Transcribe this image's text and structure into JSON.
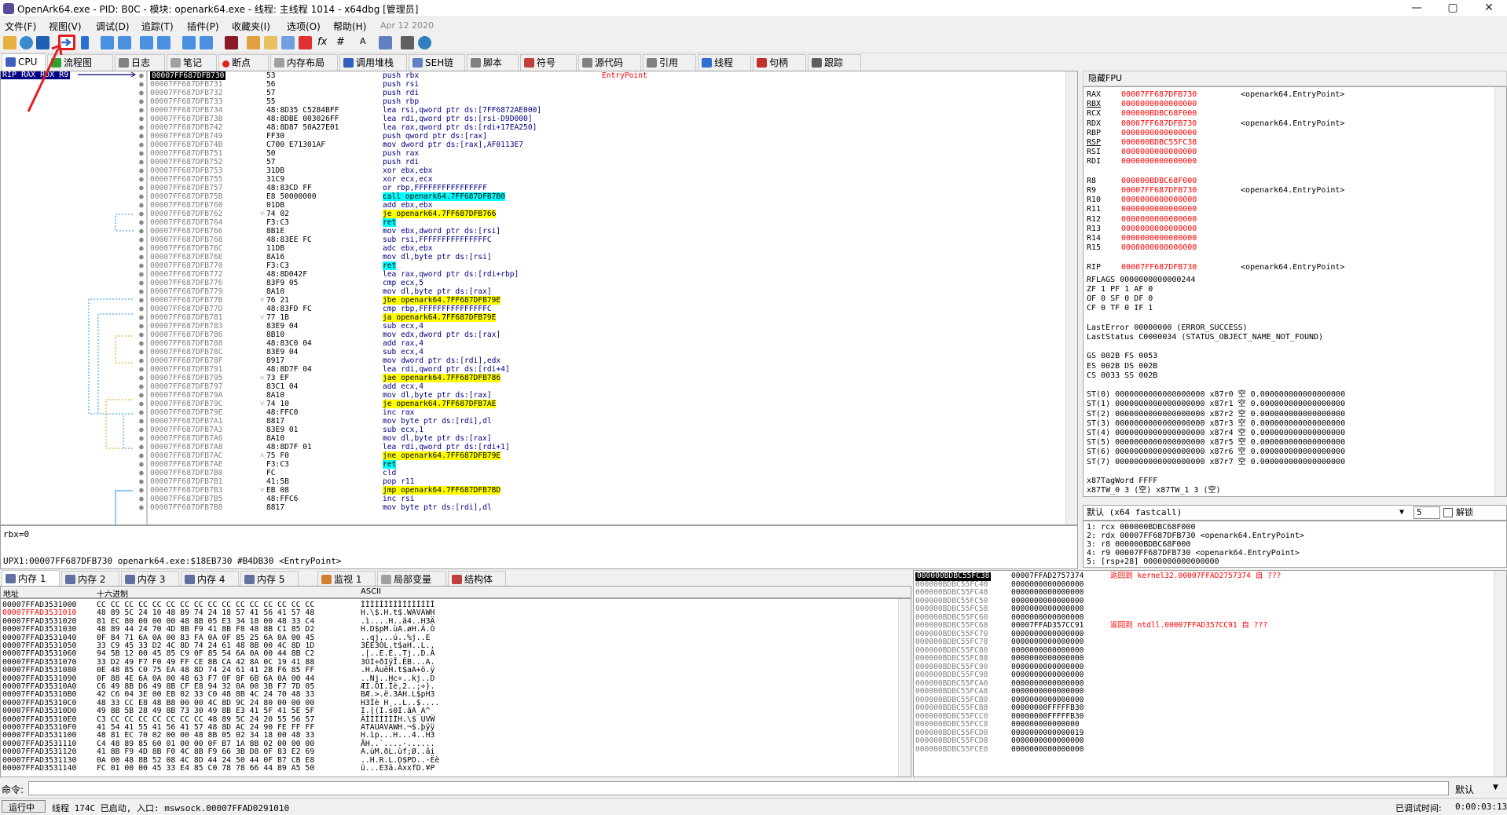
{
  "window": {
    "title": "OpenArk64.exe - PID: B0C - 模块: openark64.exe - 线程: 主线程 1014 - x64dbg [管理员]",
    "min": "—",
    "max": "▢",
    "close": "✕"
  },
  "menu": {
    "items": [
      "文件(F)",
      "视图(V)",
      "调试(D)",
      "追踪(T)",
      "插件(P)",
      "收藏夹(I)",
      "选项(O)",
      "帮助(H)"
    ],
    "date": "Apr 12 2020"
  },
  "tabs": [
    {
      "label": "CPU",
      "color": "#4060c0"
    },
    {
      "label": "流程图",
      "color": "#30a030"
    },
    {
      "label": "日志",
      "color": "#808080"
    },
    {
      "label": "笔记",
      "color": "#a0a0a0"
    },
    {
      "label": "断点",
      "color": "#e02020"
    },
    {
      "label": "内存布局",
      "color": "#a0a0a0"
    },
    {
      "label": "调用堆栈",
      "color": "#3060c0"
    },
    {
      "label": "SEH链",
      "color": "#6080c0"
    },
    {
      "label": "脚本",
      "color": "#808080"
    },
    {
      "label": "符号",
      "color": "#c04040"
    },
    {
      "label": "源代码",
      "color": "#808080"
    },
    {
      "label": "引用",
      "color": "#808080"
    },
    {
      "label": "线程",
      "color": "#3070d0"
    },
    {
      "label": "句柄",
      "color": "#c03030"
    },
    {
      "label": "跟踪",
      "color": "#606060"
    }
  ],
  "rip_label": "RIP RAX RDX R9",
  "disasm": [
    {
      "addr": "00007FF687DFB730",
      "bytes": "53",
      "asm": "push rbx",
      "cmt": "EntryPoint",
      "cur": true
    },
    {
      "addr": "00007FF687DFB731",
      "bytes": "56",
      "asm": "push rsi"
    },
    {
      "addr": "00007FF687DFB732",
      "bytes": "57",
      "asm": "push rdi"
    },
    {
      "addr": "00007FF687DFB733",
      "bytes": "55",
      "asm": "push rbp"
    },
    {
      "addr": "00007FF687DFB734",
      "bytes": "48:8D35 C5284BFF",
      "asm": "lea rsi,qword ptr ds:[7FF6872AE000]"
    },
    {
      "addr": "00007FF687DFB73B",
      "bytes": "48:8DBE 003026FF",
      "asm": "lea rdi,qword ptr ds:[rsi-D9D000]"
    },
    {
      "addr": "00007FF687DFB742",
      "bytes": "48:8D87 50A27E01",
      "asm": "lea rax,qword ptr ds:[rdi+17EA250]"
    },
    {
      "addr": "00007FF687DFB749",
      "bytes": "FF30",
      "asm": "push qword ptr ds:[rax]"
    },
    {
      "addr": "00007FF687DFB74B",
      "bytes": "C700 E71301AF",
      "asm": "mov dword ptr ds:[rax],AF0113E7"
    },
    {
      "addr": "00007FF687DFB751",
      "bytes": "50",
      "asm": "push rax"
    },
    {
      "addr": "00007FF687DFB752",
      "bytes": "57",
      "asm": "push rdi"
    },
    {
      "addr": "00007FF687DFB753",
      "bytes": "31DB",
      "asm": "xor ebx,ebx"
    },
    {
      "addr": "00007FF687DFB755",
      "bytes": "31C9",
      "asm": "xor ecx,ecx"
    },
    {
      "addr": "00007FF687DFB757",
      "bytes": "48:83CD FF",
      "asm": "or rbp,FFFFFFFFFFFFFFFF"
    },
    {
      "addr": "00007FF687DFB75B",
      "bytes": "E8 50000000",
      "asm": "call openark64.7FF687DFB7B0",
      "hl": "call"
    },
    {
      "addr": "00007FF687DFB760",
      "bytes": "01DB",
      "asm": "add ebx,ebx"
    },
    {
      "addr": "00007FF687DFB762",
      "bytes": "74 02",
      "asm": "je openark64.7FF687DFB766",
      "hl": "jmp",
      "arrow": "˅"
    },
    {
      "addr": "00007FF687DFB764",
      "bytes": "F3:C3",
      "asm": "ret",
      "hl": "call"
    },
    {
      "addr": "00007FF687DFB766",
      "bytes": "8B1E",
      "asm": "mov ebx,dword ptr ds:[rsi]"
    },
    {
      "addr": "00007FF687DFB768",
      "bytes": "48:83EE FC",
      "asm": "sub rsi,FFFFFFFFFFFFFFFC"
    },
    {
      "addr": "00007FF687DFB76C",
      "bytes": "11DB",
      "asm": "adc ebx,ebx"
    },
    {
      "addr": "00007FF687DFB76E",
      "bytes": "8A16",
      "asm": "mov dl,byte ptr ds:[rsi]"
    },
    {
      "addr": "00007FF687DFB770",
      "bytes": "F3:C3",
      "asm": "ret",
      "hl": "call"
    },
    {
      "addr": "00007FF687DFB772",
      "bytes": "48:8D042F",
      "asm": "lea rax,qword ptr ds:[rdi+rbp]"
    },
    {
      "addr": "00007FF687DFB776",
      "bytes": "83F9 05",
      "asm": "cmp ecx,5"
    },
    {
      "addr": "00007FF687DFB779",
      "bytes": "8A10",
      "asm": "mov dl,byte ptr ds:[rax]"
    },
    {
      "addr": "00007FF687DFB77B",
      "bytes": "76 21",
      "asm": "jbe openark64.7FF687DFB79E",
      "hl": "jmp",
      "arrow": "˅"
    },
    {
      "addr": "00007FF687DFB77D",
      "bytes": "48:83FD FC",
      "asm": "cmp rbp,FFFFFFFFFFFFFFFC"
    },
    {
      "addr": "00007FF687DFB781",
      "bytes": "77 1B",
      "asm": "ja openark64.7FF687DFB79E",
      "hl": "jmp",
      "arrow": "˅"
    },
    {
      "addr": "00007FF687DFB783",
      "bytes": "83E9 04",
      "asm": "sub ecx,4"
    },
    {
      "addr": "00007FF687DFB786",
      "bytes": "8B10",
      "asm": "mov edx,dword ptr ds:[rax]"
    },
    {
      "addr": "00007FF687DFB788",
      "bytes": "48:83C0 04",
      "asm": "add rax,4"
    },
    {
      "addr": "00007FF687DFB78C",
      "bytes": "83E9 04",
      "asm": "sub ecx,4"
    },
    {
      "addr": "00007FF687DFB78F",
      "bytes": "8917",
      "asm": "mov dword ptr ds:[rdi],edx"
    },
    {
      "addr": "00007FF687DFB791",
      "bytes": "48:8D7F 04",
      "asm": "lea rdi,qword ptr ds:[rdi+4]"
    },
    {
      "addr": "00007FF687DFB795",
      "bytes": "73 EF",
      "asm": "jae openark64.7FF687DFB786",
      "hl": "jmp",
      "arrow": "˄"
    },
    {
      "addr": "00007FF687DFB797",
      "bytes": "83C1 04",
      "asm": "add ecx,4"
    },
    {
      "addr": "00007FF687DFB79A",
      "bytes": "8A10",
      "asm": "mov dl,byte ptr ds:[rax]"
    },
    {
      "addr": "00007FF687DFB79C",
      "bytes": "74 10",
      "asm": "je openark64.7FF687DFB7AE",
      "hl": "jmp",
      "arrow": "˅"
    },
    {
      "addr": "00007FF687DFB79E",
      "bytes": "48:FFC0",
      "asm": "inc rax"
    },
    {
      "addr": "00007FF687DFB7A1",
      "bytes": "8817",
      "asm": "mov byte ptr ds:[rdi],dl"
    },
    {
      "addr": "00007FF687DFB7A3",
      "bytes": "83E9 01",
      "asm": "sub ecx,1"
    },
    {
      "addr": "00007FF687DFB7A6",
      "bytes": "8A10",
      "asm": "mov dl,byte ptr ds:[rax]"
    },
    {
      "addr": "00007FF687DFB7A8",
      "bytes": "48:8D7F 01",
      "asm": "lea rdi,qword ptr ds:[rdi+1]"
    },
    {
      "addr": "00007FF687DFB7AC",
      "bytes": "75 F0",
      "asm": "jne openark64.7FF687DFB79E",
      "hl": "jmp",
      "arrow": "˄"
    },
    {
      "addr": "00007FF687DFB7AE",
      "bytes": "F3:C3",
      "asm": "ret",
      "hl": "call"
    },
    {
      "addr": "00007FF687DFB7B0",
      "bytes": "FC",
      "asm": "cld"
    },
    {
      "addr": "00007FF687DFB7B1",
      "bytes": "41:5B",
      "asm": "pop r11"
    },
    {
      "addr": "00007FF687DFB7B3",
      "bytes": "EB 08",
      "asm": "jmp openark64.7FF687DFB7BD",
      "hl": "jmp",
      "arrow": "˅"
    },
    {
      "addr": "00007FF687DFB7B5",
      "bytes": "48:FFC6",
      "asm": "inc rsi"
    },
    {
      "addr": "00007FF687DFB7B8",
      "bytes": "8817",
      "asm": "mov byte ptr ds:[rdi],dl"
    }
  ],
  "info": {
    "line1": "rbx=0",
    "line2": "UPX1:00007FF687DFB730 openark64.exe:$18EB730 #B4DB30 <EntryPoint>"
  },
  "reg_header": "隐藏FPU",
  "registers": [
    {
      "n": "RAX",
      "v": "00007FF687DFB730",
      "c": "<openark64.EntryPoint>",
      "red": true
    },
    {
      "n": "RBX",
      "v": "0000000000000000",
      "u": true,
      "red": true
    },
    {
      "n": "RCX",
      "v": "000000BDBC68F000",
      "red": true
    },
    {
      "n": "RDX",
      "v": "00007FF687DFB730",
      "c": "<openark64.EntryPoint>",
      "red": true
    },
    {
      "n": "RBP",
      "v": "0000000000000000",
      "red": true
    },
    {
      "n": "RSP",
      "v": "000000BDBC55FC38",
      "u": true,
      "red": true
    },
    {
      "n": "RSI",
      "v": "0000000000000000",
      "red": true
    },
    {
      "n": "RDI",
      "v": "0000000000000000",
      "red": true
    },
    {
      "n": "",
      "v": ""
    },
    {
      "n": "R8",
      "v": "000000BDBC68F000",
      "red": true
    },
    {
      "n": "R9",
      "v": "00007FF687DFB730",
      "c": "<openark64.EntryPoint>",
      "red": true
    },
    {
      "n": "R10",
      "v": "0000000000000000",
      "red": true
    },
    {
      "n": "R11",
      "v": "0000000000000000",
      "red": true
    },
    {
      "n": "R12",
      "v": "0000000000000000",
      "red": true
    },
    {
      "n": "R13",
      "v": "0000000000000000",
      "red": true
    },
    {
      "n": "R14",
      "v": "0000000000000000",
      "red": true
    },
    {
      "n": "R15",
      "v": "0000000000000000",
      "red": true
    },
    {
      "n": "",
      "v": ""
    },
    {
      "n": "RIP",
      "v": "00007FF687DFB730",
      "c": "<openark64.EntryPoint>",
      "red": true
    }
  ],
  "flags": [
    "RFLAGS  0000000000000244",
    "ZF 1  PF 1  AF 0",
    "OF 0  SF 0  DF 0",
    "CF 0  TF 0  IF 1",
    "",
    "LastError  00000000 (ERROR_SUCCESS)",
    "LastStatus C0000034 (STATUS_OBJECT_NAME_NOT_FOUND)",
    "",
    "GS 002B  FS 0053",
    "ES 002B  DS 002B",
    "CS 0033  SS 002B",
    "",
    "ST(0) 0000000000000000000 x87r0 空 0.000000000000000000",
    "ST(1) 0000000000000000000 x87r1 空 0.000000000000000000",
    "ST(2) 0000000000000000000 x87r2 空 0.000000000000000000",
    "ST(3) 0000000000000000000 x87r3 空 0.000000000000000000",
    "ST(4) 0000000000000000000 x87r4 空 0.000000000000000000",
    "ST(5) 0000000000000000000 x87r5 空 0.000000000000000000",
    "ST(6) 0000000000000000000 x87r6 空 0.000000000000000000",
    "ST(7) 0000000000000000000 x87r7 空 0.000000000000000000",
    "",
    "x87TagWord FFFF",
    "x87TW_0 3 (空)       x87TW_1 3 (空)"
  ],
  "callconv": {
    "label": "默认 (x64 fastcall)",
    "count": "5",
    "unlock": "解锁"
  },
  "args": [
    "1: rcx 000000BDBC68F000",
    "2: rdx 00007FF687DFB730 <openark64.EntryPoint>",
    "3: r8 000000BDBC68F000",
    "4: r9 00007FF687DFB730 <openark64.EntryPoint>",
    "5: [rsp+28] 0000000000000000"
  ],
  "mem_tabs": [
    "内存 1",
    "内存 2",
    "内存 3",
    "内存 4",
    "内存 5",
    "监视 1",
    "局部变量",
    "结构体"
  ],
  "mem_head": {
    "addr": "地址",
    "hex": "十六进制",
    "ascii": "ASCII"
  },
  "memory": [
    {
      "a": "00007FFAD3531000",
      "h": "CC CC CC CC CC CC CC CC CC CC CC CC CC CC CC CC",
      "t": "ÌÌÌÌÌÌÌÌÌÌÌÌÌÌÌÌ"
    },
    {
      "a": "00007FFAD3531010",
      "h": "48 89 5C 24 10 48 89 74 24 18 57 41 56 41 57 48",
      "t": "H.\\$.H.t$.WAVAWH",
      "red": true
    },
    {
      "a": "00007FFAD3531020",
      "h": "81 EC 80 00 00 00 48 8B 05 E3 34 18 00 48 33 C4",
      "t": ".ì....H..ã4..H3Ä"
    },
    {
      "a": "00007FFAD3531030",
      "h": "48 89 44 24 70 4D 8B F9 41 8B F8 48 8B C1 85 D2",
      "t": "H.D$pM.ùA.øH.Á.Ò"
    },
    {
      "a": "00007FFAD3531040",
      "h": "0F 84 71 6A 0A 00 83 FA 0A 0F 85 25 6A 0A 00 45",
      "t": "..qj...ú..%j..E"
    },
    {
      "a": "00007FFAD3531050",
      "h": "33 C9 45 33 D2 4C 8D 74 24 61 48 8B 00 4C 8D 1D",
      "t": "3ÉE3ÒL.t$aH..L.."
    },
    {
      "a": "00007FFAD3531060",
      "h": "94 5B 12 00 45 85 C9 0F 85 54 6A 0A 00 44 8B C2",
      "t": ".[..E.É..Tj..D.Â"
    },
    {
      "a": "00007FFAD3531070",
      "h": "33 D2 49 F7 F0 49 FF CE 8B CA 42 8A 0C 19 41 88",
      "t": "3ÒI÷ðIÿÎ.ÊB...A."
    },
    {
      "a": "00007FFAD3531080",
      "h": "0E 48 85 C0 75 EA 48 8D 74 24 61 41 2B F6 85 FF",
      "t": ".H.ÀuêH.t$aA+ö.ÿ"
    },
    {
      "a": "00007FFAD3531090",
      "h": "0F 88 4E 6A 0A 00 48 63 F7 0F 8F 6B 6A 0A 00 44",
      "t": "..Nj..Hc÷..kj..D"
    },
    {
      "a": "00007FFAD35310A0",
      "h": "C6 49 8B D6 49 8B CF E8 94 32 0A 00 3B F7 7D 05",
      "t": "ÆI.ÖI.Ïè.2..;÷}."
    },
    {
      "a": "00007FFAD35310B0",
      "h": "42 C6 04 3E 00 EB 02 33 C0 48 8B 4C 24 70 48 33",
      "t": "BÆ.>.ë.3ÀH.L$pH3"
    },
    {
      "a": "00007FFAD35310C0",
      "h": "48 33 CC E8 48 B8 00 00 4C 8D 9C 24 80 00 00 00",
      "t": "H3Ìè H¸..L..$...."
    },
    {
      "a": "00007FFAD35310D0",
      "h": "49 8B 5B 28 49 8B 73 30 49 8B E3 41 5F 41 5E 5F",
      "t": "I.[(I.s0I.ãA_A^_"
    },
    {
      "a": "00007FFAD35310E0",
      "h": "C3 CC CC CC CC CC CC CC 48 89 5C 24 20 55 56 57",
      "t": "ÃÌÌÌÌÌÌÌH.\\$ UVW"
    },
    {
      "a": "00007FFAD35310F0",
      "h": "41 54 41 55 41 56 41 57 48 8D AC 24 90 FE FF FF",
      "t": "ATAUAVAWH.¬$.þÿÿ"
    },
    {
      "a": "00007FFAD3531100",
      "h": "48 81 EC 70 02 00 00 48 8B 05 02 34 18 00 48 33",
      "t": "H.ìp...H...4..H3"
    },
    {
      "a": "00007FFAD3531110",
      "h": "C4 48 89 85 60 01 00 00 0F B7 1A 8B 02 00 00 00",
      "t": "ÄH..`....·......"
    },
    {
      "a": "00007FFAD3531120",
      "h": "41 8B F9 4D 8B F0 4C 8B F9 66 3B D8 0F 83 E2 69",
      "t": "A.ùM.ðL.ùf;Ø..âi"
    },
    {
      "a": "00007FFAD3531130",
      "h": "0A 00 48 8B 52 08 4C 8D 44 24 50 44 0F B7 CB E8",
      "t": "..H.R.L.D$PD..·Ëè"
    },
    {
      "a": "00007FFAD3531140",
      "h": "FC 01 00 00 45 33 E4 85 C0 78 78 66 44 89 A5 50",
      "t": "ü...E3ä.ÀxxfD.¥P"
    }
  ],
  "stack": [
    {
      "a": "000000BDBC55FC38",
      "v": "00007FFAD2757374",
      "c": "返回到 kernel32.00007FFAD2757374 自 ???",
      "cur": true
    },
    {
      "a": "000000BDBC55FC40",
      "v": "0000000000000000"
    },
    {
      "a": "000000BDBC55FC48",
      "v": "0000000000000000"
    },
    {
      "a": "000000BDBC55FC50",
      "v": "0000000000000000"
    },
    {
      "a": "000000BDBC55FC58",
      "v": "0000000000000000"
    },
    {
      "a": "000000BDBC55FC60",
      "v": "0000000000000000"
    },
    {
      "a": "000000BDBC55FC68",
      "v": "00007FFAD357CC91",
      "c": "返回到 ntdll.00007FFAD357CC91 自 ???"
    },
    {
      "a": "000000BDBC55FC70",
      "v": "0000000000000000"
    },
    {
      "a": "000000BDBC55FC78",
      "v": "0000000000000000"
    },
    {
      "a": "000000BDBC55FC80",
      "v": "0000000000000000"
    },
    {
      "a": "000000BDBC55FC88",
      "v": "0000000000000000"
    },
    {
      "a": "000000BDBC55FC90",
      "v": "0000000000000000"
    },
    {
      "a": "000000BDBC55FC98",
      "v": "0000000000000000"
    },
    {
      "a": "000000BDBC55FCA0",
      "v": "0000000000000000"
    },
    {
      "a": "000000BDBC55FCA8",
      "v": "0000000000000000"
    },
    {
      "a": "000000BDBC55FCB0",
      "v": "0000000000000000"
    },
    {
      "a": "000000BDBC55FCB8",
      "v": "00000000FFFFFB30"
    },
    {
      "a": "000000BDBC55FCC0",
      "v": "00000000FFFFFB30"
    },
    {
      "a": "000000BDBC55FCC8",
      "v": "000000000000000"
    },
    {
      "a": "000000BDBC55FCD0",
      "v": "0000000000000019"
    },
    {
      "a": "000000BDBC55FCD8",
      "v": "0000000000000000"
    },
    {
      "a": "000000BDBC55FCE0",
      "v": "0000000000000000"
    }
  ],
  "cmd": {
    "label": "命令:",
    "value": "",
    "right": "默认"
  },
  "status": {
    "state": "运行中",
    "msg": "线程 174C 已启动, 入口: mswsock.00007FFAD0291010",
    "time_label": "已调试时间:",
    "time": "0:00:03:13"
  },
  "colors": {
    "accent": "#ff0000",
    "rip": "#000080",
    "call_hl": "#00ffff",
    "jmp_hl": "#ffff00"
  }
}
